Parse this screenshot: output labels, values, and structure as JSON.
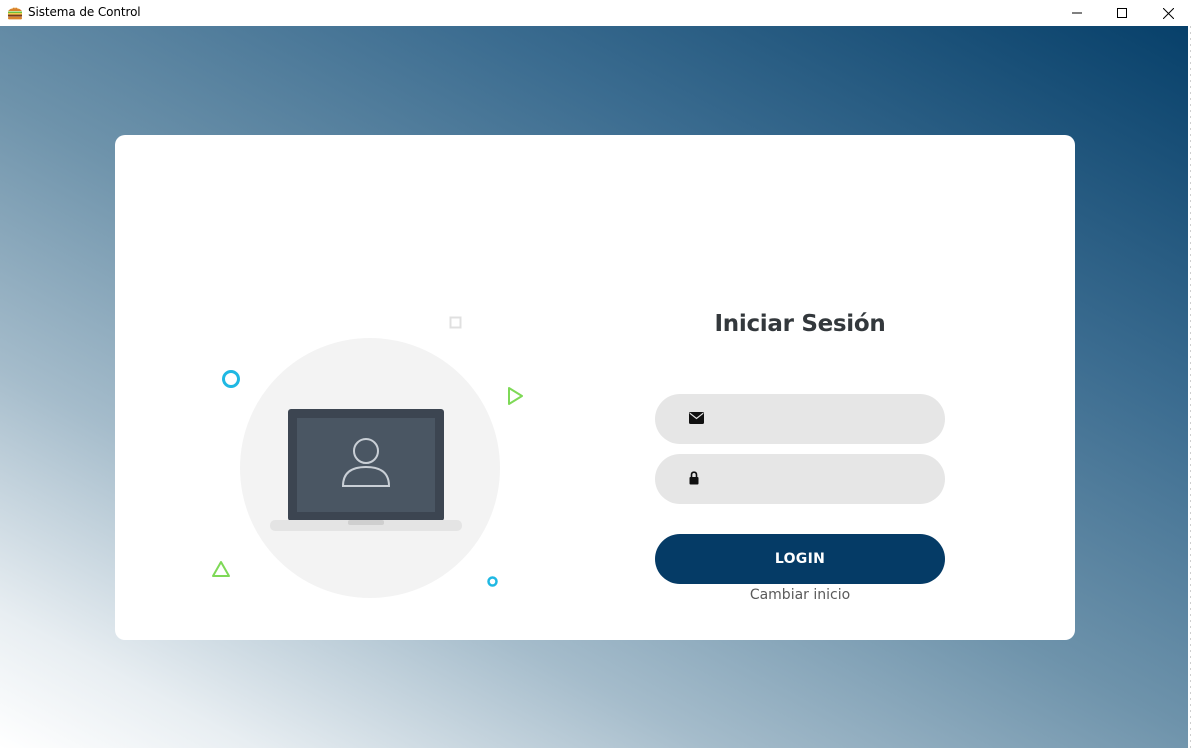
{
  "window": {
    "title": "Sistema de Control",
    "icon": "burger-app-icon",
    "controls": [
      "minimize-icon",
      "maximize-icon",
      "close-icon"
    ]
  },
  "colors": {
    "accent": "#053b66",
    "field_bg": "#e6e6e6",
    "deco_blue": "#1fb8e3",
    "deco_green": "#7ed957",
    "gradient": [
      "#07406a",
      "#6e93ab",
      "#ffffff"
    ]
  },
  "login": {
    "title": "Iniciar Sesión",
    "email_icon": "envelope-icon",
    "email_value": "",
    "password_icon": "lock-icon",
    "password_value": "",
    "button_label": "LOGIN",
    "change_link": "Cambiar inicio"
  },
  "illustration": {
    "main": "laptop-user-icon",
    "decorations": [
      "circle-outline",
      "square-outline",
      "triangle-outline",
      "play-triangle-outline",
      "small-circle-outline"
    ]
  }
}
